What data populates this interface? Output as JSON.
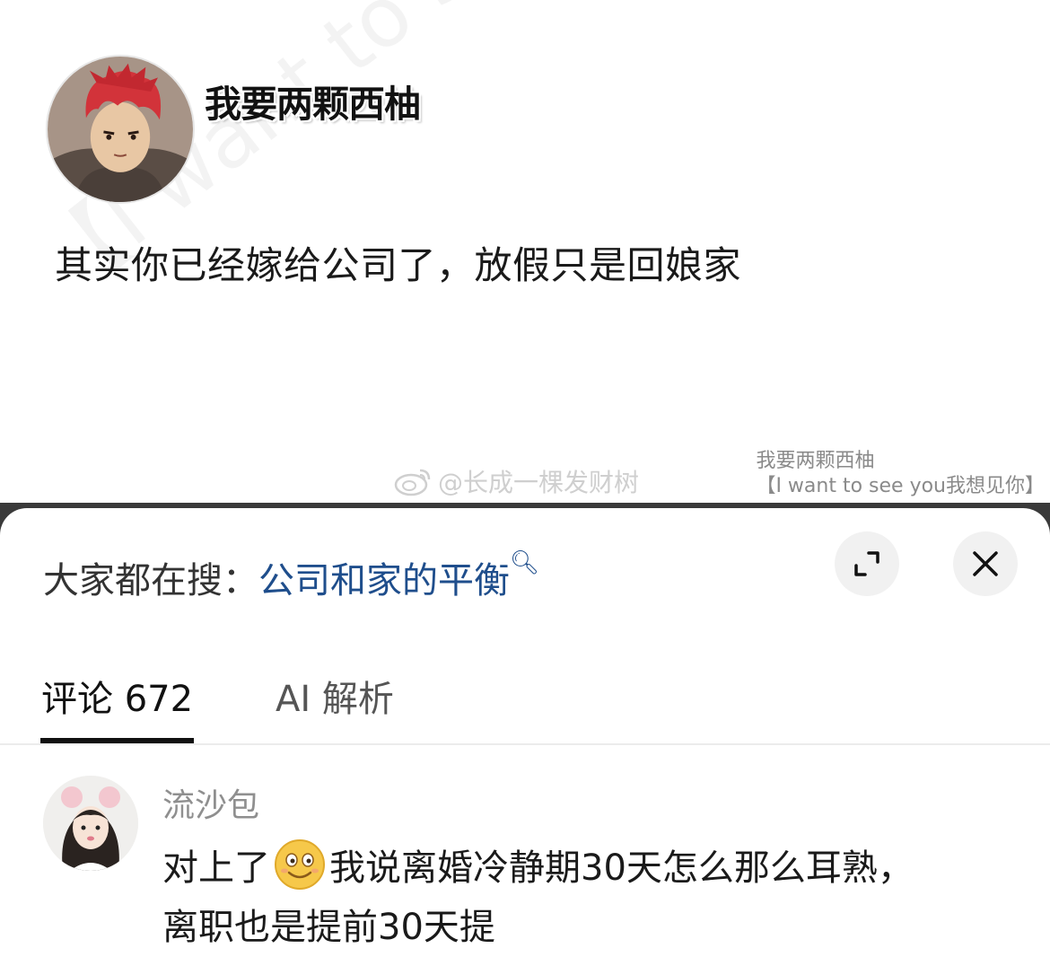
{
  "post": {
    "author": "我要两颗西柚",
    "text": "其实你已经嫁给公司了，放假只是回娘家",
    "watermark_diagonal": "【I want to see you我想见你",
    "weibo_mark": "@长成一棵发财树",
    "signature_line1": "我要两颗西柚",
    "signature_line2": "【I want to see you我想见你】"
  },
  "sheet": {
    "search_prefix": "大家都在搜：",
    "search_term": "公司和家的平衡",
    "expand_icon": "expand-icon",
    "close_icon": "close-icon"
  },
  "tabs": [
    {
      "label": "评论 672",
      "active": true
    },
    {
      "label": "AI 解析",
      "active": false
    }
  ],
  "comment": {
    "user": "流沙包",
    "text_before_emoji": "对上了",
    "emoji": "smiling-face-emoji",
    "text_after_emoji": "我说离婚冷静期30天怎么那么耳熟，",
    "text_line2": "离职也是提前30天提"
  },
  "colors": {
    "search_term": "#1f4e8c",
    "username": "#8f8f8f",
    "tab_underline": "#111111",
    "emoji_face": "#f6c84a"
  }
}
